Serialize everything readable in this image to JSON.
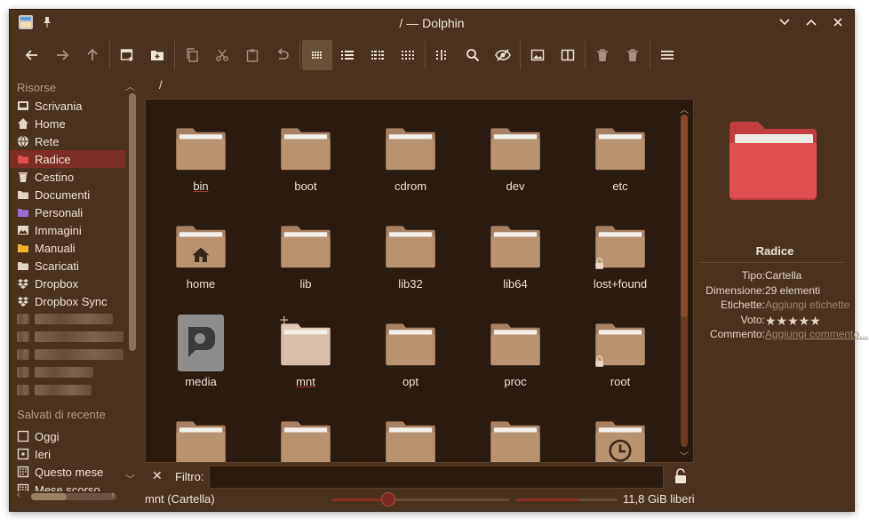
{
  "window": {
    "title": "/ — Dolphin",
    "accent": "#7c2e24",
    "background": "#4a321d",
    "view_background": "#2b1a0e"
  },
  "toolbar": [
    {
      "name": "back-button",
      "icon": "arrow-left-icon"
    },
    {
      "name": "forward-button",
      "icon": "arrow-right-icon"
    },
    {
      "name": "up-button",
      "icon": "arrow-up-icon"
    },
    {
      "name": "new-window-button",
      "icon": "new-window-icon"
    },
    {
      "name": "new-folder-button",
      "icon": "new-folder-icon"
    },
    {
      "name": "copy-button",
      "icon": "copy-icon"
    },
    {
      "name": "cut-button",
      "icon": "scissors-icon"
    },
    {
      "name": "paste-button",
      "icon": "clipboard-icon"
    },
    {
      "name": "undo-button",
      "icon": "undo-icon"
    },
    {
      "name": "icons-view-button",
      "icon": "icons-view-icon",
      "active": true
    },
    {
      "name": "details-view-button",
      "icon": "list-view-icon"
    },
    {
      "name": "compact-view-button",
      "icon": "compact-view-icon"
    },
    {
      "name": "tree-view-button",
      "icon": "grid-dots-icon"
    },
    {
      "name": "columns-button",
      "icon": "columns-icon"
    },
    {
      "name": "search-button",
      "icon": "search-icon"
    },
    {
      "name": "hidden-files-button",
      "icon": "eye-slash-icon"
    },
    {
      "name": "preview-button",
      "icon": "image-icon"
    },
    {
      "name": "split-view-button",
      "icon": "split-view-icon"
    },
    {
      "name": "trash-button",
      "icon": "trash-icon"
    },
    {
      "name": "delete-button",
      "icon": "delete-icon"
    },
    {
      "name": "menu-button",
      "icon": "hamburger-icon"
    }
  ],
  "sidebar": {
    "places_title": "Risorse",
    "places": [
      {
        "label": "Scrivania",
        "icon": "desktop-icon"
      },
      {
        "label": "Home",
        "icon": "home-icon"
      },
      {
        "label": "Rete",
        "icon": "network-icon"
      },
      {
        "label": "Radice",
        "icon": "folder-red-icon",
        "selected": true
      },
      {
        "label": "Cestino",
        "icon": "trash-icon"
      },
      {
        "label": "Documenti",
        "icon": "documents-icon"
      },
      {
        "label": "Personali",
        "icon": "folder-purple-icon"
      },
      {
        "label": "Immagini",
        "icon": "pictures-icon"
      },
      {
        "label": "Manuali",
        "icon": "folder-yellow-icon"
      },
      {
        "label": "Scaricati",
        "icon": "downloads-icon"
      },
      {
        "label": "Dropbox",
        "icon": "dropbox-icon"
      },
      {
        "label": "Dropbox Sync",
        "icon": "dropbox-icon"
      }
    ],
    "recent_title": "Salvati di recente",
    "recent": [
      {
        "label": "Oggi",
        "icon": "calendar-day-icon"
      },
      {
        "label": "Ieri",
        "icon": "calendar-yesterday-icon"
      },
      {
        "label": "Questo mese",
        "icon": "calendar-month-icon"
      },
      {
        "label": "Mese scorso",
        "icon": "calendar-month-icon"
      }
    ]
  },
  "breadcrumb": "/",
  "files": [
    {
      "name": "bin",
      "type": "folder",
      "highlight": true
    },
    {
      "name": "boot",
      "type": "folder"
    },
    {
      "name": "cdrom",
      "type": "folder"
    },
    {
      "name": "dev",
      "type": "folder"
    },
    {
      "name": "etc",
      "type": "folder"
    },
    {
      "name": "home",
      "type": "folder-home"
    },
    {
      "name": "lib",
      "type": "folder"
    },
    {
      "name": "lib32",
      "type": "folder"
    },
    {
      "name": "lib64",
      "type": "folder"
    },
    {
      "name": "lost+found",
      "type": "folder-locked"
    },
    {
      "name": "media",
      "type": "drive"
    },
    {
      "name": "mnt",
      "type": "folder-hover",
      "highlight": true
    },
    {
      "name": "opt",
      "type": "folder"
    },
    {
      "name": "proc",
      "type": "folder"
    },
    {
      "name": "root",
      "type": "folder-locked"
    },
    {
      "name": "",
      "type": "folder"
    },
    {
      "name": "",
      "type": "folder"
    },
    {
      "name": "",
      "type": "folder"
    },
    {
      "name": "",
      "type": "folder"
    },
    {
      "name": "",
      "type": "folder-clock"
    }
  ],
  "info": {
    "name": "Radice",
    "rows": [
      {
        "key": "Tipo:",
        "value": "Cartella"
      },
      {
        "key": "Dimensione:",
        "value": "29 elementi"
      },
      {
        "key": "Etichette:",
        "value": "Aggiungi etichette",
        "style": "muted"
      },
      {
        "key": "Voto:",
        "value": "★★★★★",
        "style": "stars"
      },
      {
        "key": "Commento:",
        "value": "Aggiungi commento...",
        "style": "link"
      }
    ],
    "folder_color": "#e05050"
  },
  "filter": {
    "label": "Filtro:",
    "value": ""
  },
  "status": {
    "text": "mnt (Cartella)",
    "free": "11,8 GiB liberi"
  }
}
